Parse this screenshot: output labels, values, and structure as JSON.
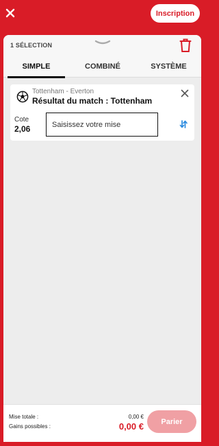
{
  "header": {
    "signup_label": "Inscription"
  },
  "betslip": {
    "selection_count": "1 SÉLECTION",
    "tabs": [
      {
        "label": "SIMPLE",
        "active": true
      },
      {
        "label": "COMBINÉ",
        "active": false
      },
      {
        "label": "SYSTÈME",
        "active": false
      }
    ],
    "selection": {
      "event": "Tottenham - Everton",
      "market": "Résultat du match : Tottenham",
      "odds_label": "Cote",
      "odds_value": "2,06",
      "stake_placeholder": "Saisissez votre mise"
    },
    "footer": {
      "total_stake_label": "Mise totale :",
      "total_stake_value": "0,00 €",
      "potential_win_label": "Gains possibles :",
      "potential_win_value": "0,00 €",
      "place_bet_label": "Parier"
    }
  },
  "colors": {
    "brand": "#d91c27",
    "disabled_button": "#f0a0a4",
    "panel_bg": "#ededed"
  },
  "icons": [
    "close-icon",
    "drag-handle-icon",
    "trash-icon",
    "soccer-ball-icon",
    "remove-selection-icon",
    "swap-icon"
  ]
}
